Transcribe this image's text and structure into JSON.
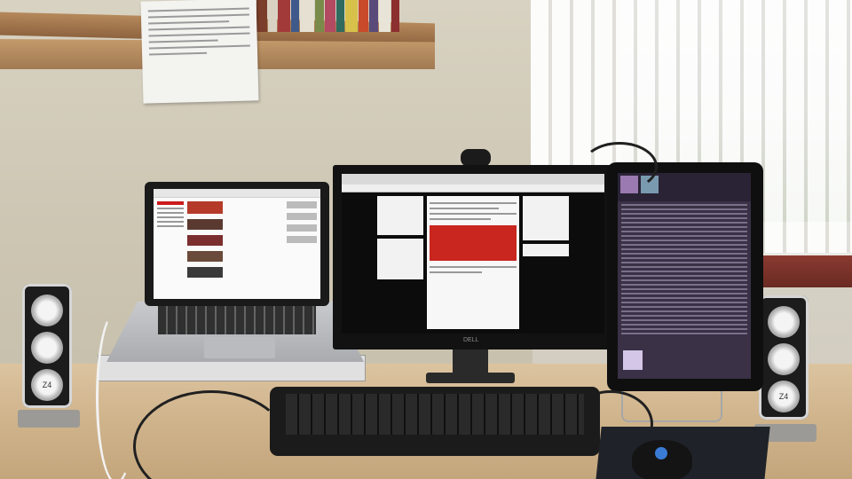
{
  "scene": {
    "monitor_brand": "DELL",
    "speaker_logo_text": "Z4"
  }
}
